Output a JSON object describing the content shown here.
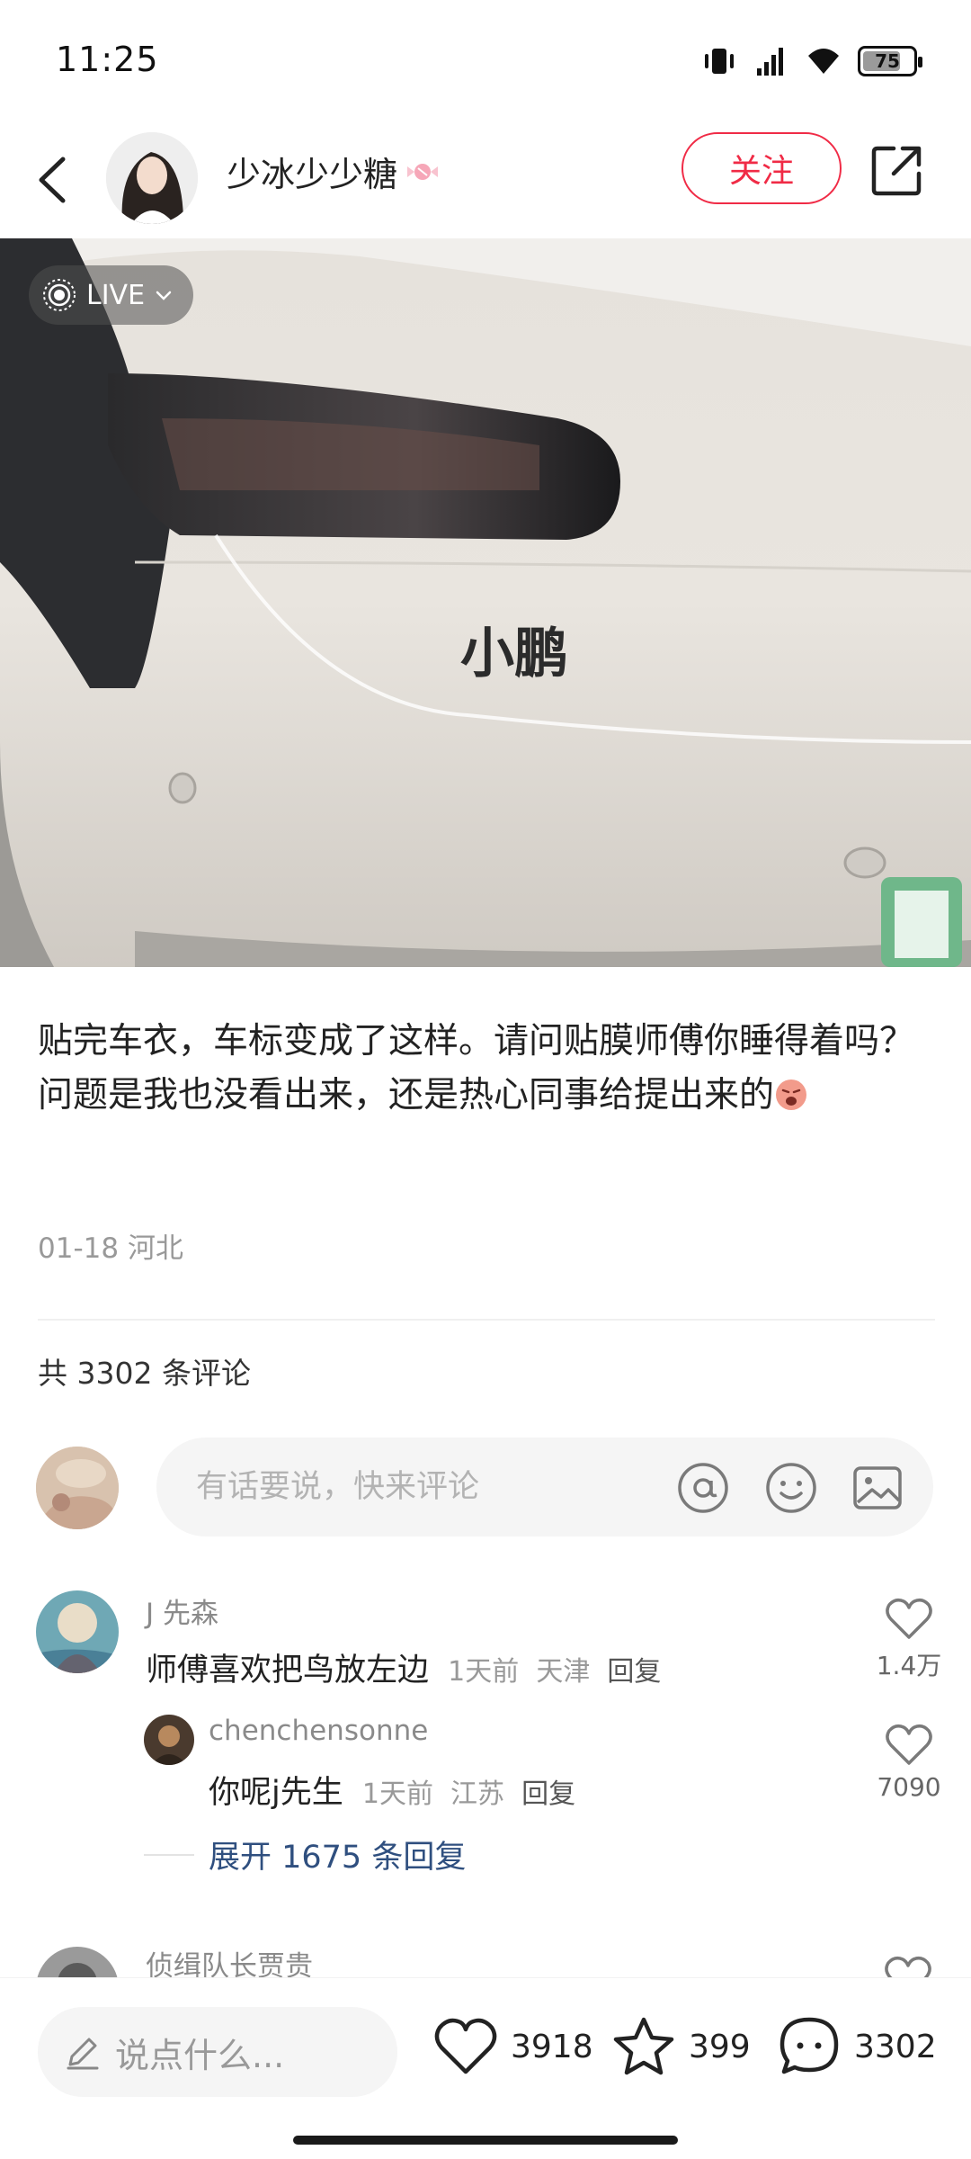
{
  "status_bar": {
    "time": "11:25",
    "battery": "75",
    "battery_fraction": 0.75
  },
  "header": {
    "author_name": "少冰少少糖",
    "follow_label": "关注"
  },
  "photo": {
    "live_label": "LIVE",
    "badge_text": "小鹏"
  },
  "post": {
    "caption_line1": "贴完车衣，车标变成了这样。请问贴膜师傅你睡得着吗？",
    "caption_line2": "问题是我也没看出来，还是热心同事给提出来的",
    "date": "01-18",
    "location": "河北",
    "comment_total_label": "共 3302 条评论"
  },
  "comment_input": {
    "placeholder": "有话要说，快来评论"
  },
  "comments": [
    {
      "user": "J 先森",
      "text": "师傅喜欢把鸟放左边",
      "time": "1天前",
      "location": "天津",
      "reply_label": "回复",
      "likes": "1.4万"
    }
  ],
  "replies": [
    {
      "user": "chenchensonne",
      "text": "你呢j先生",
      "time": "1天前",
      "location": "江苏",
      "reply_label": "回复",
      "likes": "7090"
    }
  ],
  "expand_label": "展开 1675 条回复",
  "next_comment_user": "侦缉队长贾贵",
  "bottom_bar": {
    "input_label": "说点什么...",
    "likes": "3918",
    "favorites": "399",
    "comments": "3302"
  }
}
